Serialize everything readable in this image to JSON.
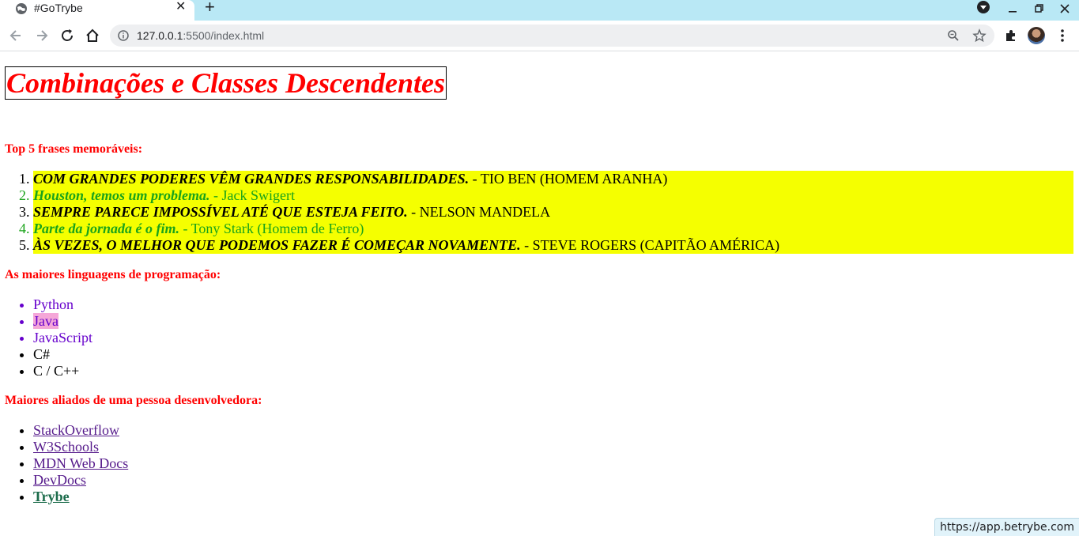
{
  "browser": {
    "tab_title": "#GoTrybe",
    "url_host": "127.0.0.1",
    "url_rest": ":5500/index.html",
    "status_url": "https://app.betrybe.com",
    "icons": [
      "globe-icon",
      "close-icon",
      "plus-icon",
      "back-icon",
      "forward-icon",
      "reload-icon",
      "home-icon",
      "info-icon",
      "zoom-icon",
      "star-icon",
      "puzzle-icon",
      "kebab-menu-icon"
    ]
  },
  "page": {
    "title": "Combinações e Classes Descendentes",
    "quotes_heading": "Top 5 frases memoráveis:",
    "quotes": [
      {
        "quote": "Com grandes poderes vêm grandes responsabilidades.",
        "author": " - Tio Ben (Homem Aranha)"
      },
      {
        "quote": "Houston, temos um problema.",
        "author": " - Jack Swigert"
      },
      {
        "quote": "Sempre parece impossível até que esteja feito.",
        "author": " - Nelson Mandela"
      },
      {
        "quote": "Parte da jornada é o fim.",
        "author": " - Tony Stark (Homem de Ferro)"
      },
      {
        "quote": "Às vezes, o melhor que podemos fazer é começar novamente.",
        "author": " - Steve Rogers (Capitão América)"
      }
    ],
    "languages_heading": "As maiores linguagens de programação:",
    "languages": [
      "Python",
      "Java",
      "JavaScript",
      "C#",
      "C / C++"
    ],
    "allies_heading": "Maiores aliados de uma pessoa desenvolvedora:",
    "allies": [
      "StackOverflow",
      "W3Schools",
      "MDN Web Docs",
      "DevDocs",
      "Trybe"
    ]
  },
  "colors": {
    "heading_red": "#ff0000",
    "highlight_yellow": "#f5ff00",
    "green_text": "#1aa31a",
    "purple_text": "#6600cc",
    "pink_highlight": "#f5a7d8",
    "tab_strip": "#b9e8f5"
  }
}
